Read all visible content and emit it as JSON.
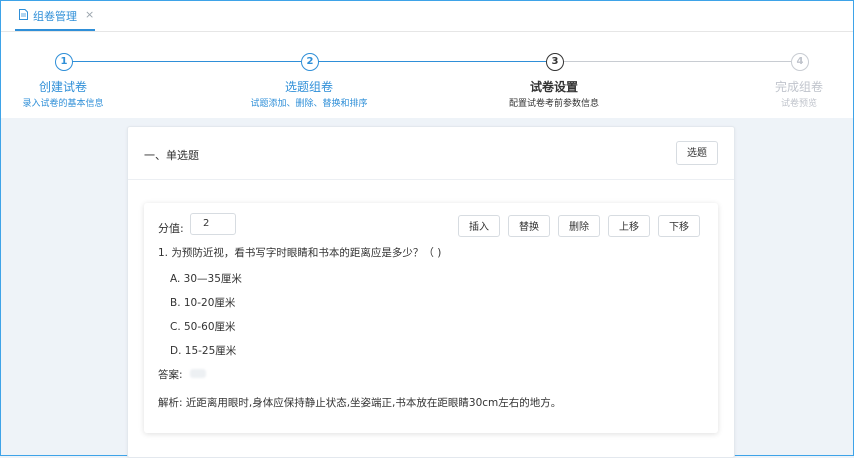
{
  "tab": {
    "label": "组卷管理",
    "close": "×"
  },
  "steps": [
    {
      "number": "1",
      "title": "创建试卷",
      "desc": "录入试卷的基本信息"
    },
    {
      "number": "2",
      "title": "选题组卷",
      "desc": "试题添加、删除、替换和排序"
    },
    {
      "number": "3",
      "title": "试卷设置",
      "desc": "配置试卷考前参数信息"
    },
    {
      "number": "4",
      "title": "完成组卷",
      "desc": "试卷预览"
    }
  ],
  "section": {
    "title": "一、单选题",
    "select_button": "选题"
  },
  "question": {
    "score_label": "分值:",
    "score_value": "2",
    "actions": {
      "insert": "插入",
      "replace": "替换",
      "delete": "删除",
      "move_up": "上移",
      "move_down": "下移"
    },
    "stem": "1.   为预防近视，看书写字时眼睛和书本的距离应是多少？（ )",
    "options": [
      "A. 30—35厘米",
      "B. 10-20厘米",
      "C. 50-60厘米",
      "D. 15-25厘米"
    ],
    "answer_label": "答案:",
    "analysis": "解析:  近距离用眼时,身体应保持静止状态,坐姿端正,书本放在距眼睛30cm左右的地方。"
  },
  "colors": {
    "active": "#2f8fd8",
    "current": "#333333",
    "pending": "#c0c4cc"
  }
}
